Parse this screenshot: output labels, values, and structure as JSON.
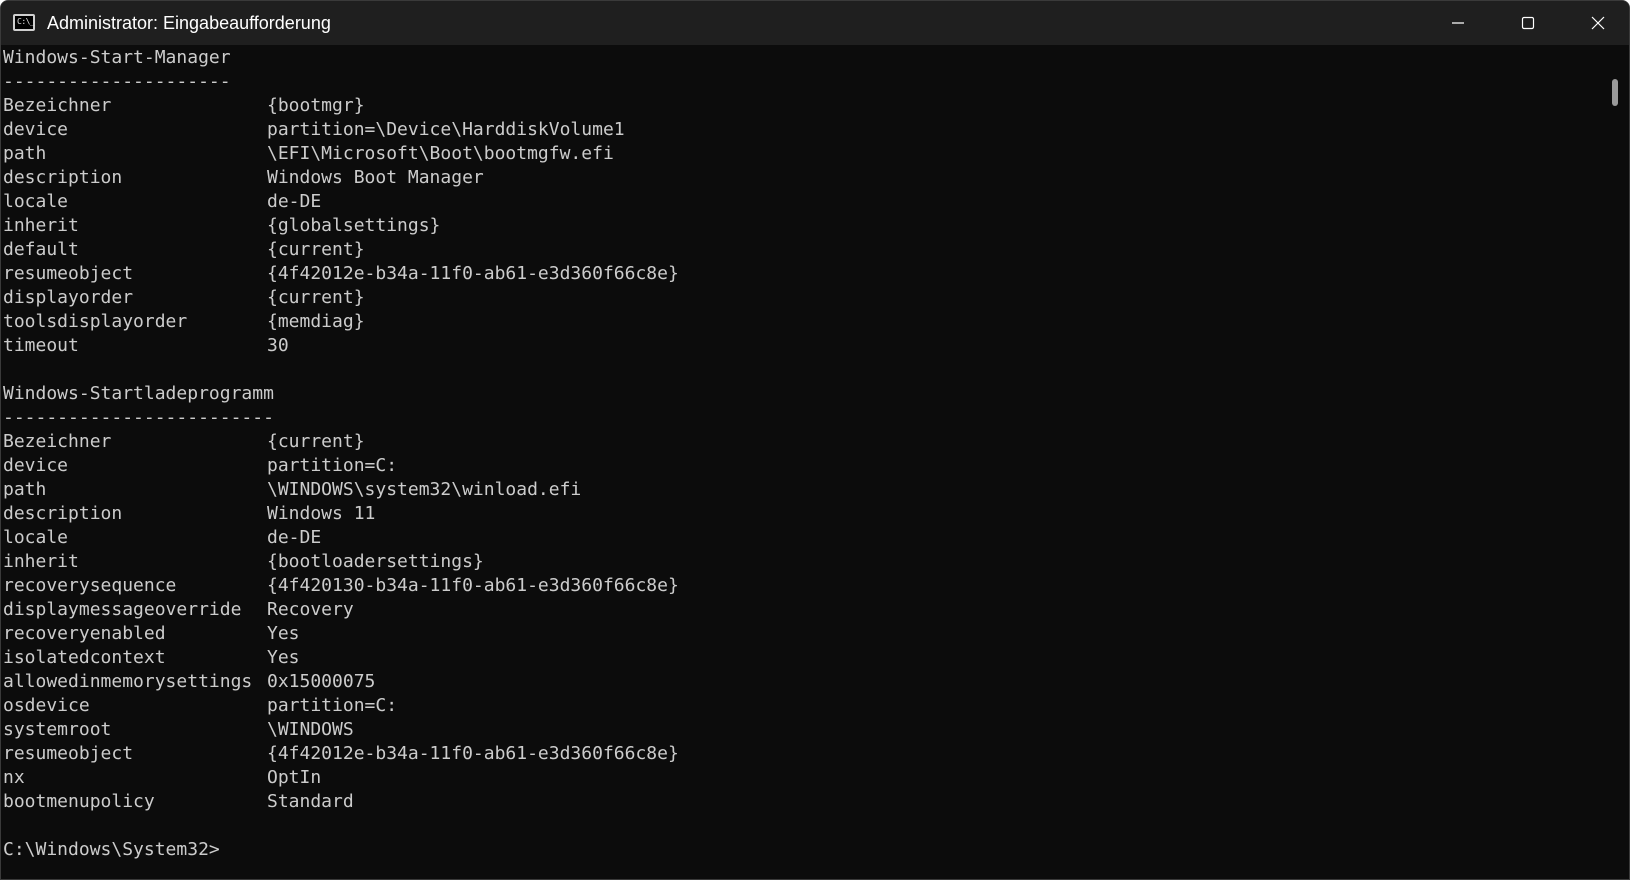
{
  "window": {
    "title": "Administrator: Eingabeaufforderung",
    "app_icon_text": "C:\\_",
    "accent": "#0c0c0c",
    "titlebar_color": "#1f1f1f",
    "text_color": "#cccccc"
  },
  "captions": {
    "minimize_icon": "minimize-icon",
    "maximize_icon": "maximize-icon",
    "close_icon": "close-icon"
  },
  "console": {
    "section1": {
      "heading": "Windows-Start-Manager",
      "underline": "---------------------",
      "entries": [
        {
          "key": "Bezeichner",
          "value": "{bootmgr}"
        },
        {
          "key": "device",
          "value": "partition=\\Device\\HarddiskVolume1"
        },
        {
          "key": "path",
          "value": "\\EFI\\Microsoft\\Boot\\bootmgfw.efi"
        },
        {
          "key": "description",
          "value": "Windows Boot Manager"
        },
        {
          "key": "locale",
          "value": "de-DE"
        },
        {
          "key": "inherit",
          "value": "{globalsettings}"
        },
        {
          "key": "default",
          "value": "{current}"
        },
        {
          "key": "resumeobject",
          "value": "{4f42012e-b34a-11f0-ab61-e3d360f66c8e}"
        },
        {
          "key": "displayorder",
          "value": "{current}"
        },
        {
          "key": "toolsdisplayorder",
          "value": "{memdiag}"
        },
        {
          "key": "timeout",
          "value": "30"
        }
      ]
    },
    "section2": {
      "heading": "Windows-Startladeprogramm",
      "underline": "-------------------------",
      "entries": [
        {
          "key": "Bezeichner",
          "value": "{current}"
        },
        {
          "key": "device",
          "value": "partition=C:"
        },
        {
          "key": "path",
          "value": "\\WINDOWS\\system32\\winload.efi"
        },
        {
          "key": "description",
          "value": "Windows 11"
        },
        {
          "key": "locale",
          "value": "de-DE"
        },
        {
          "key": "inherit",
          "value": "{bootloadersettings}"
        },
        {
          "key": "recoverysequence",
          "value": "{4f420130-b34a-11f0-ab61-e3d360f66c8e}"
        },
        {
          "key": "displaymessageoverride",
          "value": "Recovery"
        },
        {
          "key": "recoveryenabled",
          "value": "Yes"
        },
        {
          "key": "isolatedcontext",
          "value": "Yes"
        },
        {
          "key": "allowedinmemorysettings",
          "value": "0x15000075"
        },
        {
          "key": "osdevice",
          "value": "partition=C:"
        },
        {
          "key": "systemroot",
          "value": "\\WINDOWS"
        },
        {
          "key": "resumeobject",
          "value": "{4f42012e-b34a-11f0-ab61-e3d360f66c8e}"
        },
        {
          "key": "nx",
          "value": "OptIn"
        },
        {
          "key": "bootmenupolicy",
          "value": "Standard"
        }
      ]
    },
    "prompt": "C:\\Windows\\System32>"
  }
}
